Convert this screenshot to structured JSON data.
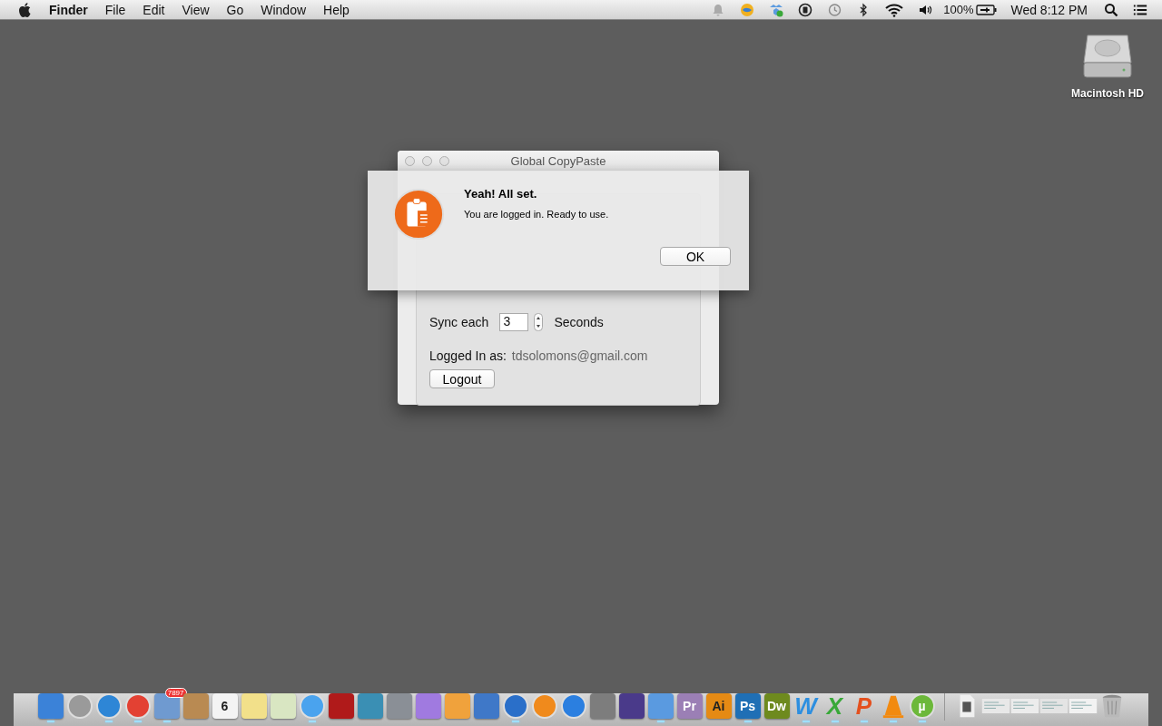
{
  "menu_bar": {
    "app_name": "Finder",
    "menus": [
      "File",
      "Edit",
      "View",
      "Go",
      "Window",
      "Help"
    ],
    "battery": "100%",
    "clock": "Wed 8:12 PM"
  },
  "desktop_icons": [
    {
      "label": "Macintosh HD"
    }
  ],
  "window": {
    "title": "Global CopyPaste",
    "sync_label": "Sync each",
    "sync_value": "3",
    "sync_unit": "Seconds",
    "logged_in_label": "Logged In as:",
    "email": "tdsolomons@gmail.com",
    "logout_button": "Logout"
  },
  "alert": {
    "title": "Yeah! All set.",
    "message": "You are logged in. Ready to use.",
    "ok_button": "OK"
  },
  "dock": [
    {
      "kind": "square",
      "color": "#3b82d8",
      "running": true
    },
    {
      "kind": "circle",
      "color": "#9a9a9a",
      "running": false
    },
    {
      "kind": "circle",
      "color": "#2e86d6",
      "running": true
    },
    {
      "kind": "circle",
      "color": "#e34133",
      "running": true
    },
    {
      "kind": "square",
      "color": "#6f9ad0",
      "badge": "7897",
      "running": true
    },
    {
      "kind": "square",
      "color": "#b98a52",
      "running": false
    },
    {
      "kind": "square",
      "color": "#f4f4f4",
      "label": "6",
      "running": false
    },
    {
      "kind": "square",
      "color": "#f2e08a",
      "running": false
    },
    {
      "kind": "square",
      "color": "#d9e6c2",
      "running": false
    },
    {
      "kind": "circle",
      "color": "#4aa3ee",
      "running": true
    },
    {
      "kind": "square",
      "color": "#b01a1a",
      "running": false
    },
    {
      "kind": "square",
      "color": "#3a8fb4",
      "running": false
    },
    {
      "kind": "square",
      "color": "#8a8f96",
      "running": false
    },
    {
      "kind": "square",
      "color": "#a07ae0",
      "running": false
    },
    {
      "kind": "square",
      "color": "#f0a23c",
      "running": false
    },
    {
      "kind": "square",
      "color": "#3f78c8",
      "running": false
    },
    {
      "kind": "circle",
      "color": "#2a6fc9",
      "running": true
    },
    {
      "kind": "circle",
      "color": "#f08a1c",
      "running": false
    },
    {
      "kind": "circle",
      "color": "#2b7fe0",
      "running": false
    },
    {
      "kind": "square",
      "color": "#7d7d7d",
      "running": false
    },
    {
      "kind": "square",
      "color": "#4a3a8a",
      "running": false
    },
    {
      "kind": "square",
      "color": "#5a9ae0",
      "running": true
    },
    {
      "kind": "square",
      "color": "#9b7fb5",
      "label": "Pr",
      "running": false
    },
    {
      "kind": "square",
      "color": "#e58a14",
      "label": "Ai",
      "running": false
    },
    {
      "kind": "square",
      "color": "#1f6fb5",
      "label": "Ps",
      "running": true
    },
    {
      "kind": "square",
      "color": "#6e8a1e",
      "label": "Dw",
      "running": false
    },
    {
      "kind": "letter",
      "color": "#2d8fe0",
      "label": "W",
      "running": true
    },
    {
      "kind": "letter",
      "color": "#38a838",
      "label": "X",
      "running": true
    },
    {
      "kind": "letter",
      "color": "#e4501e",
      "label": "P",
      "running": true
    },
    {
      "kind": "cone",
      "color": "#f28a10",
      "running": true
    },
    {
      "kind": "circle",
      "color": "#6cb83a",
      "label": "µ",
      "running": true
    },
    {
      "kind": "separator"
    },
    {
      "kind": "document",
      "color": "#f0f0f0",
      "running": false
    },
    {
      "kind": "thumb",
      "color": "#e8e8e8",
      "running": false
    },
    {
      "kind": "thumb",
      "color": "#ececec",
      "running": false
    },
    {
      "kind": "thumb",
      "color": "#e4e4e4",
      "running": false
    },
    {
      "kind": "thumb",
      "color": "#f2f2f2",
      "running": false
    },
    {
      "kind": "trash",
      "color": "#b9b9b9",
      "running": false
    }
  ]
}
